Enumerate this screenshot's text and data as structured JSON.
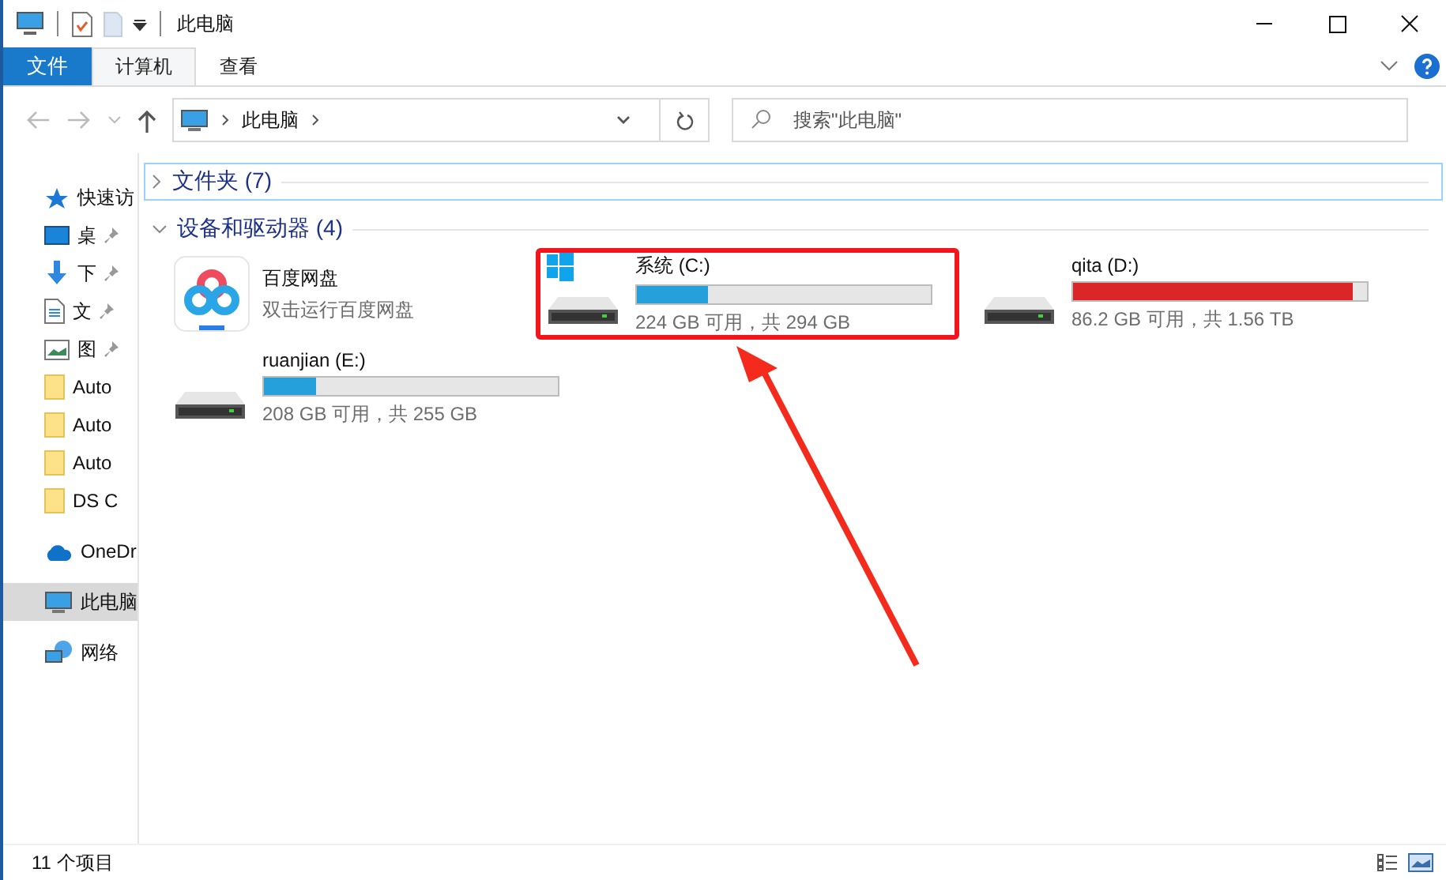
{
  "window": {
    "title": "此电脑"
  },
  "ribbon": {
    "file_tab": "文件",
    "tabs": [
      {
        "label": "计算机",
        "selected": true
      },
      {
        "label": "查看",
        "selected": false
      }
    ]
  },
  "address": {
    "crumbs": [
      "此电脑"
    ],
    "search_placeholder": "搜索\"此电脑\""
  },
  "sidebar": {
    "sections": [
      {
        "items": [
          {
            "label": "快速访",
            "kind": "star",
            "pinned": false,
            "selected": false
          },
          {
            "label": "桌",
            "kind": "desktop",
            "pinned": true,
            "selected": false
          },
          {
            "label": "下",
            "kind": "download",
            "pinned": true,
            "selected": false
          },
          {
            "label": "文",
            "kind": "document",
            "pinned": true,
            "selected": false
          },
          {
            "label": "图",
            "kind": "image",
            "pinned": true,
            "selected": false
          },
          {
            "label": "Auto",
            "kind": "folder",
            "pinned": false,
            "selected": false
          },
          {
            "label": "Auto",
            "kind": "folder",
            "pinned": false,
            "selected": false
          },
          {
            "label": "Auto",
            "kind": "folder",
            "pinned": false,
            "selected": false
          },
          {
            "label": "DS C",
            "kind": "folder",
            "pinned": false,
            "selected": false
          }
        ]
      },
      {
        "items": [
          {
            "label": "OneDr",
            "kind": "cloud",
            "pinned": false,
            "selected": false
          }
        ]
      },
      {
        "items": [
          {
            "label": "此电脑",
            "kind": "pc",
            "pinned": false,
            "selected": true
          }
        ]
      },
      {
        "items": [
          {
            "label": "网络",
            "kind": "network",
            "pinned": false,
            "selected": false
          }
        ]
      }
    ]
  },
  "groups": [
    {
      "title": "文件夹 (7)",
      "expanded": false
    },
    {
      "title": "设备和驱动器 (4)",
      "expanded": true,
      "items": [
        {
          "kind": "app",
          "name": "百度网盘",
          "subtitle": "双击运行百度网盘",
          "highlighted": false
        },
        {
          "kind": "drive",
          "name": "系统 (C:)",
          "system": true,
          "level": 0.24,
          "color": "#26a0da",
          "space": "224 GB 可用，共 294 GB",
          "highlighted": true
        },
        {
          "kind": "drive",
          "name": "qita (D:)",
          "system": false,
          "level": 0.95,
          "color": "#da2626",
          "space": "86.2 GB 可用，共 1.56 TB",
          "highlighted": false
        },
        {
          "kind": "drive",
          "name": "ruanjian (E:)",
          "system": false,
          "level": 0.18,
          "color": "#26a0da",
          "space": "208 GB 可用，共 255 GB",
          "highlighted": false
        }
      ]
    }
  ],
  "status_bar": {
    "count": "11 个项目"
  }
}
